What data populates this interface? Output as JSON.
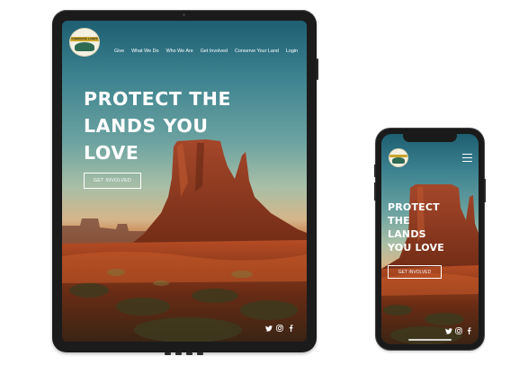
{
  "tablet": {
    "logo_text": "CONSERVE LANDS",
    "nav": [
      "Give",
      "What We Do",
      "Who We Are",
      "Get Involved",
      "Conserve Your Land",
      "Login"
    ],
    "hero_lines": [
      "PROTECT THE",
      "LANDS YOU",
      "LOVE"
    ],
    "cta_label": "GET INVOLVED",
    "social_icons": [
      "twitter-icon",
      "instagram-icon",
      "facebook-icon"
    ]
  },
  "phone": {
    "hero_lines": [
      "PROTECT",
      "THE",
      "LANDS",
      "YOU LOVE"
    ],
    "cta_label": "GET INVOLVED",
    "social_icons": [
      "twitter-icon",
      "instagram-icon",
      "facebook-icon"
    ]
  },
  "colors": {
    "sky_top": "#1e5f72",
    "rock": "#8e3a1b",
    "device": "#1b1b1c",
    "text": "#ffffff"
  }
}
